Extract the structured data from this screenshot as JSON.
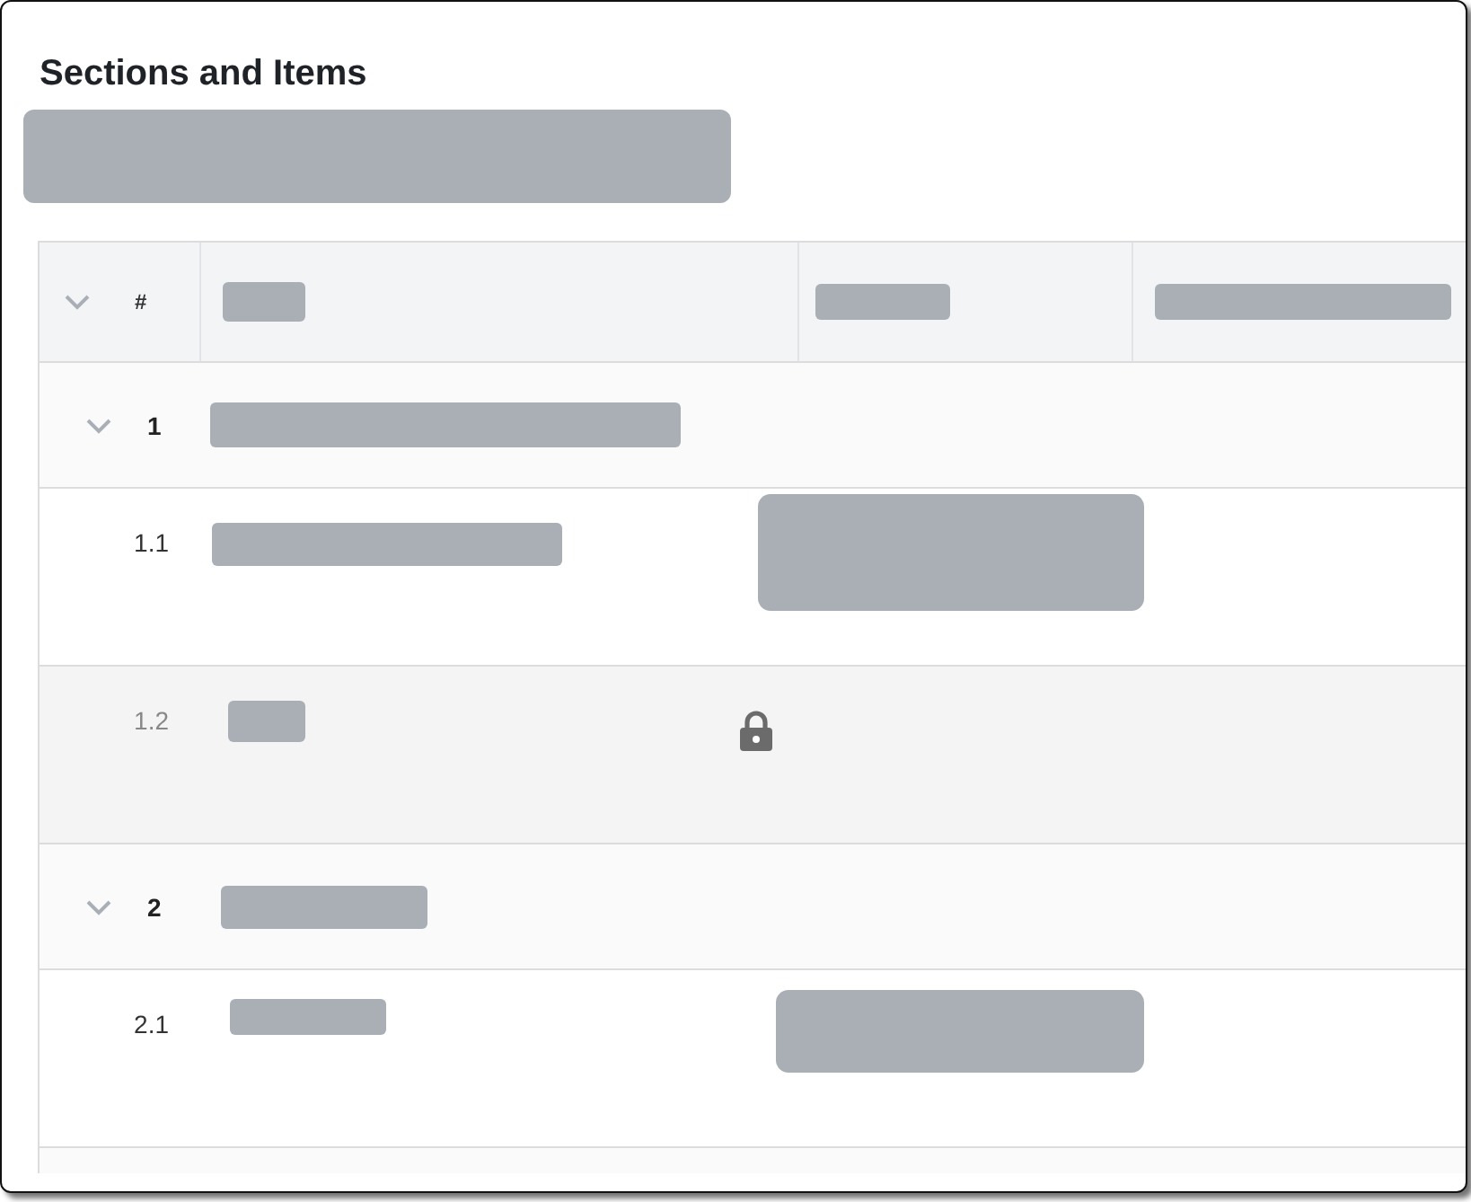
{
  "title": "Sections and Items",
  "table": {
    "header": {
      "number_label": "#"
    },
    "sections": [
      {
        "number": "1",
        "expanded": true,
        "children": [
          {
            "number": "1.1",
            "locked": false
          },
          {
            "number": "1.2",
            "locked": true
          }
        ]
      },
      {
        "number": "2",
        "expanded": true,
        "children": [
          {
            "number": "2.1",
            "locked": false
          }
        ]
      }
    ]
  }
}
